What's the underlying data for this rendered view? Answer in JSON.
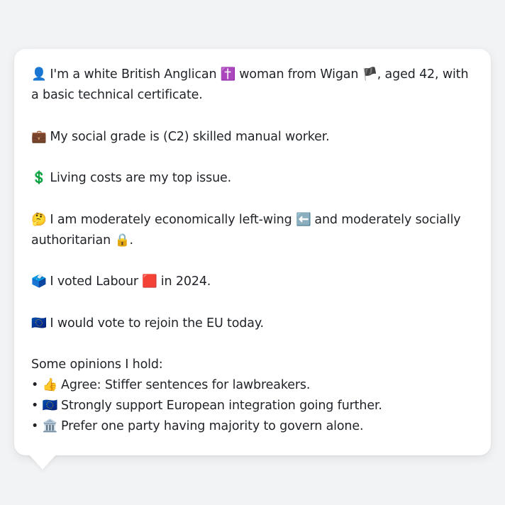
{
  "profile": {
    "identity": {
      "icon": "👤",
      "before": " I'm a white British Anglican ",
      "religion_icon": "✝️",
      "middle": " woman from Wigan ",
      "flag_icon": "🏴",
      "after": ", aged 42, with a basic technical certificate."
    },
    "grade": {
      "icon": "💼",
      "text": " My social grade is (C2) skilled manual worker."
    },
    "issue": {
      "icon": "💲",
      "text": " Living costs are my top issue."
    },
    "politics": {
      "icon": "🤔",
      "before": " I am moderately economically left-wing ",
      "left_icon": "⬅️",
      "after": " and moderately socially authoritarian ",
      "lock_icon": "🔒",
      "end": "."
    },
    "vote": {
      "icon": "🗳️",
      "before": " I voted Labour ",
      "party_icon": "🟥",
      "after": " in 2024."
    },
    "eu": {
      "icon": "🇪🇺",
      "text": " I would vote to rejoin the EU today."
    },
    "opinions": {
      "title": "Some opinions I hold:",
      "items": [
        {
          "bullet": "• ",
          "icon": "👍",
          "text": " Agree: Stiffer sentences for lawbreakers."
        },
        {
          "bullet": "• ",
          "icon": "🇪🇺",
          "text": " Strongly support European integration going further."
        },
        {
          "bullet": "• ",
          "icon": "🏛️",
          "text": " Prefer one party having majority to govern alone."
        }
      ]
    }
  }
}
